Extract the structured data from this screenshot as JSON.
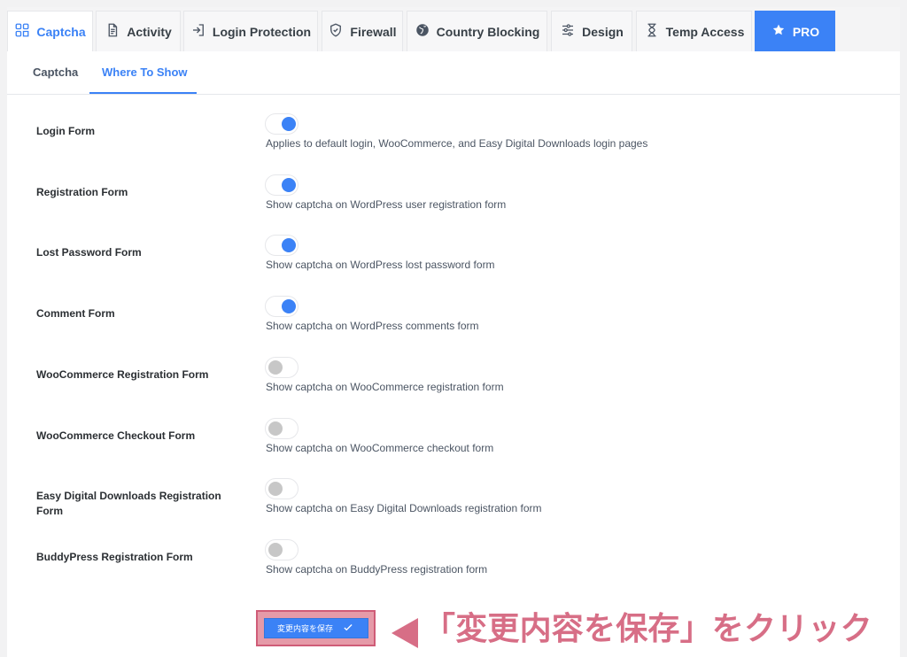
{
  "tabs": [
    {
      "label": "Captcha",
      "icon": "captcha-icon",
      "active": true
    },
    {
      "label": "Activity",
      "icon": "document-icon",
      "active": false
    },
    {
      "label": "Login Protection",
      "icon": "login-icon",
      "active": false
    },
    {
      "label": "Firewall",
      "icon": "shield-icon",
      "active": false
    },
    {
      "label": "Country Blocking",
      "icon": "globe-icon",
      "active": false
    },
    {
      "label": "Design",
      "icon": "sliders-icon",
      "active": false
    },
    {
      "label": "Temp Access",
      "icon": "hourglass-icon",
      "active": false
    },
    {
      "label": "PRO",
      "icon": "star-icon",
      "active": false
    }
  ],
  "subtabs": [
    {
      "label": "Captcha",
      "active": false
    },
    {
      "label": "Where To Show",
      "active": true
    }
  ],
  "forms": [
    {
      "label": "Login Form",
      "enabled": true,
      "description": "Applies to default login, WooCommerce, and Easy Digital Downloads login pages"
    },
    {
      "label": "Registration Form",
      "enabled": true,
      "description": "Show captcha on WordPress user registration form"
    },
    {
      "label": "Lost Password Form",
      "enabled": true,
      "description": "Show captcha on WordPress lost password form"
    },
    {
      "label": "Comment Form",
      "enabled": true,
      "description": "Show captcha on WordPress comments form"
    },
    {
      "label": "WooCommerce Registration Form",
      "enabled": false,
      "description": "Show captcha on WooCommerce registration form"
    },
    {
      "label": "WooCommerce Checkout Form",
      "enabled": false,
      "description": "Show captcha on WooCommerce checkout form"
    },
    {
      "label": "Easy Digital Downloads Registration Form",
      "enabled": false,
      "description": "Show captcha on Easy Digital Downloads registration form"
    },
    {
      "label": "BuddyPress Registration Form",
      "enabled": false,
      "description": "Show captcha on BuddyPress registration form"
    }
  ],
  "save": {
    "label": "変更内容を保存",
    "icon": "check-icon"
  },
  "annotation": {
    "text": "「変更内容を保存」をクリック",
    "icon": "arrow-left-icon"
  },
  "colors": {
    "accent": "#3b82f6",
    "annotation": "#d76e86",
    "annotation_border": "#cf5c77",
    "toggle_off": "#c7c7c7"
  }
}
